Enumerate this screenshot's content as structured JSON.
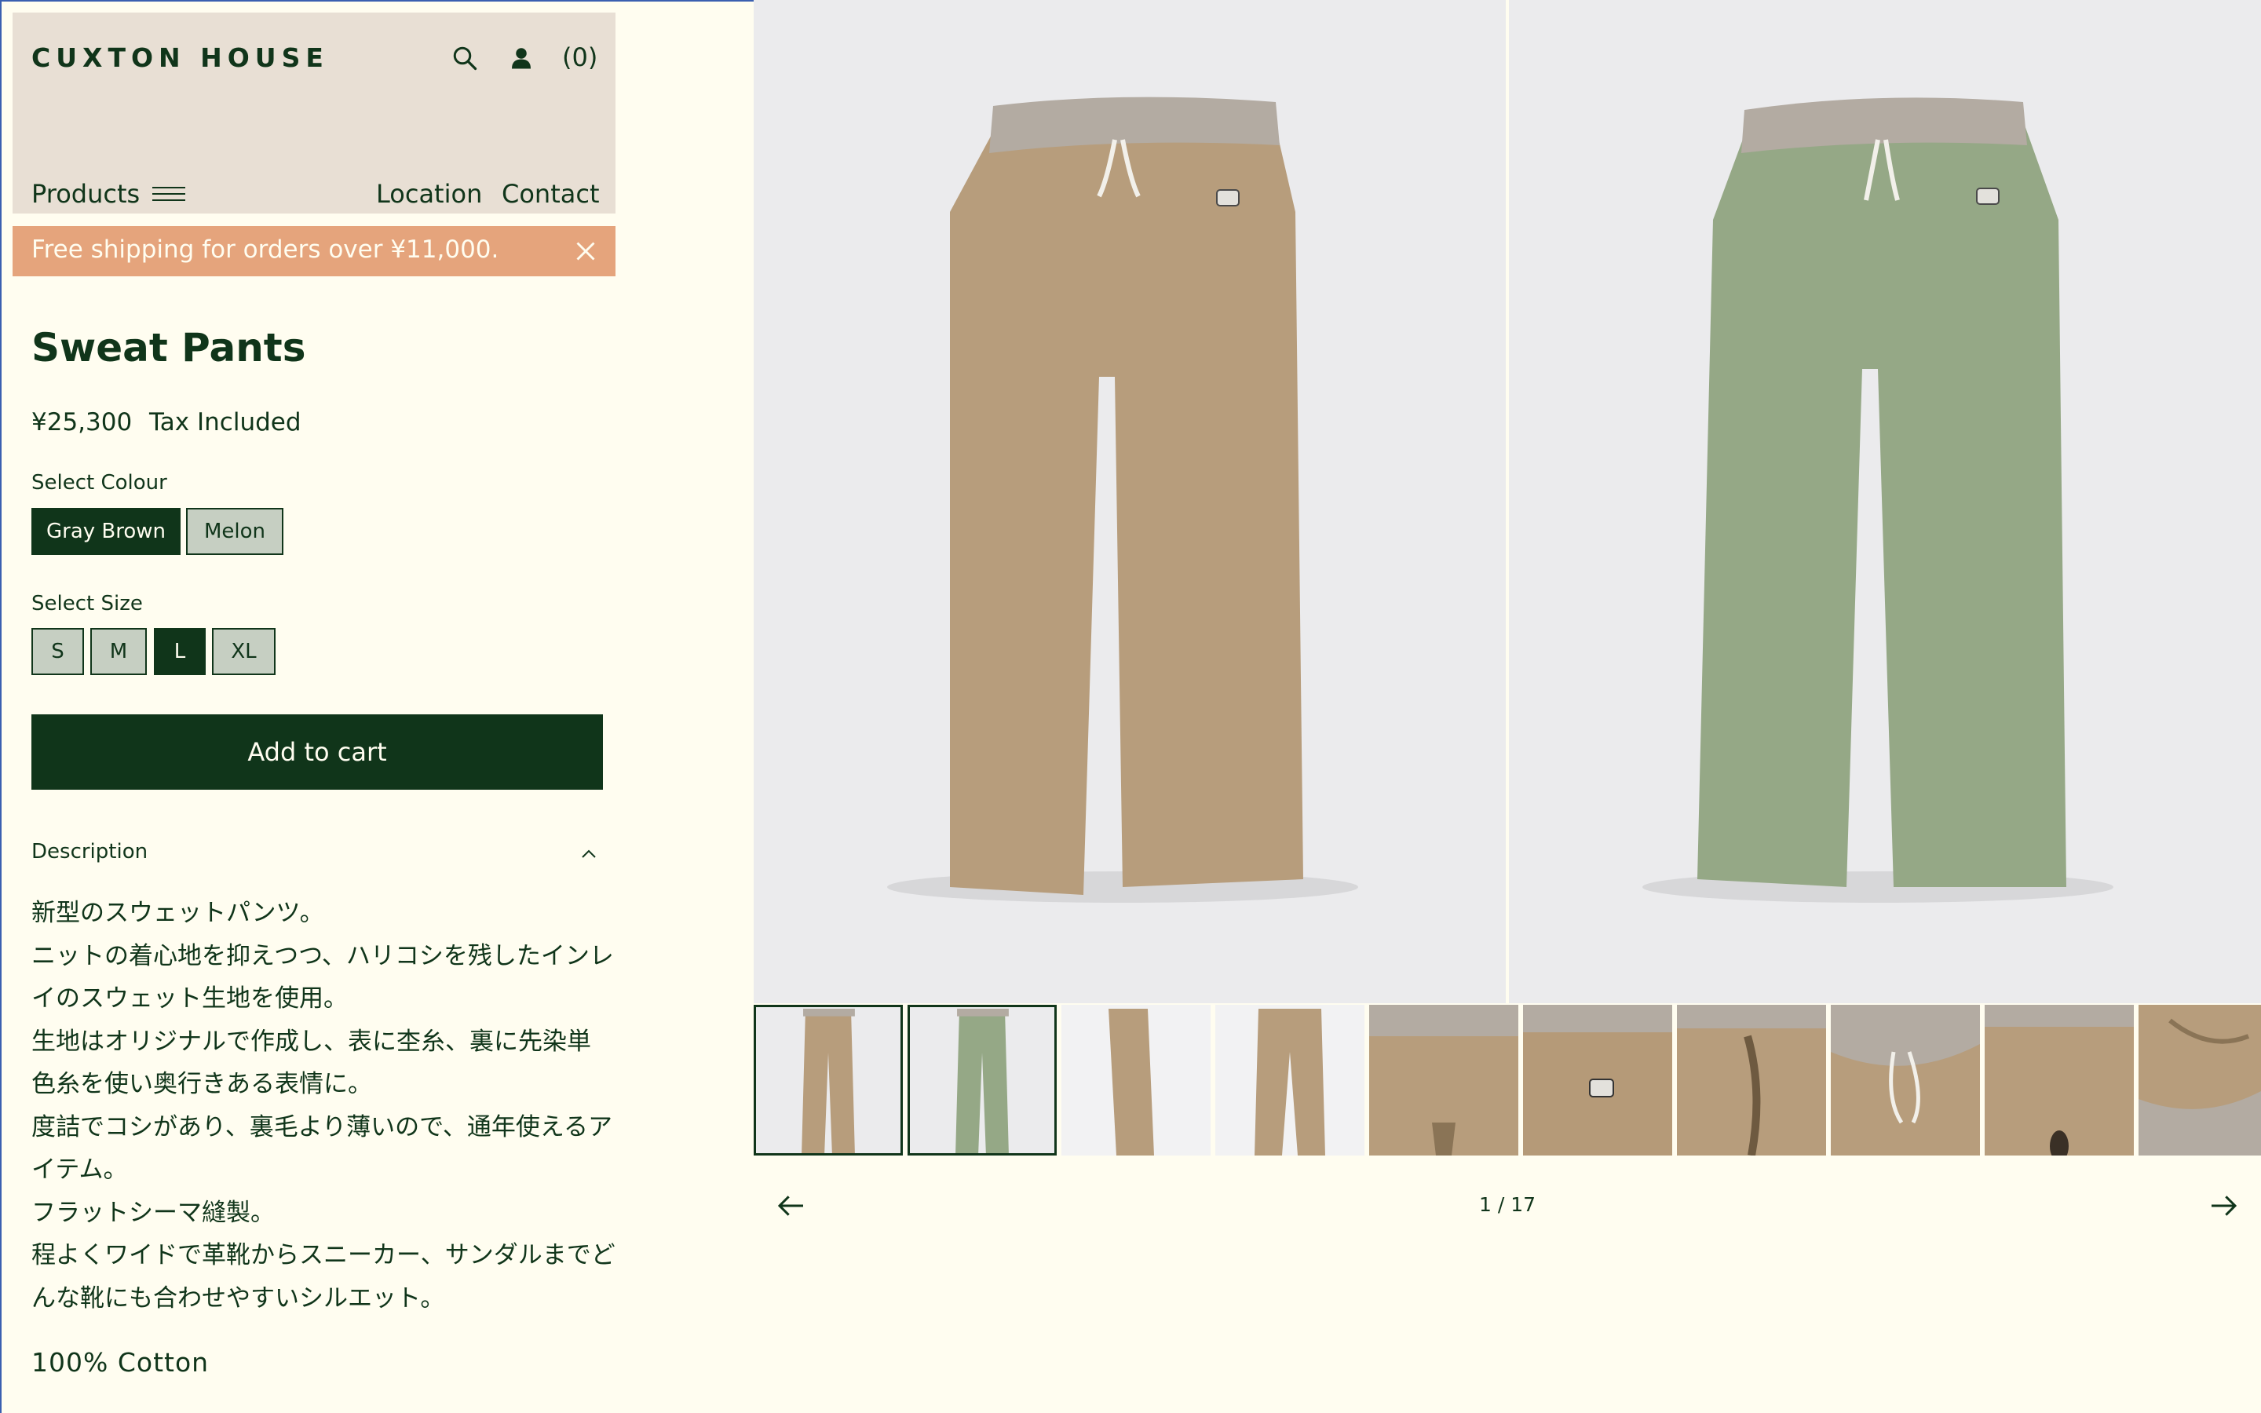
{
  "header": {
    "brand": "CUXTON HOUSE",
    "cart_count": "(0)",
    "nav": {
      "products": "Products",
      "location": "Location",
      "contact": "Contact"
    }
  },
  "banner": {
    "text": "Free shipping for orders over ¥11,000."
  },
  "product": {
    "title": "Sweat Pants",
    "price": "¥25,300",
    "tax_note": "Tax Included",
    "colour_label": "Select Colour",
    "colours": [
      "Gray Brown",
      "Melon"
    ],
    "selected_colour": "Gray Brown",
    "size_label": "Select Size",
    "sizes": [
      "S",
      "M",
      "L",
      "XL"
    ],
    "selected_size": "L",
    "add_to_cart": "Add to cart",
    "description_label": "Description",
    "description_lines": [
      "新型のスウェットパンツ。",
      "ニットの着心地を抑えつつ、ハリコシを残したインレ",
      "イのスウェット生地を使用。",
      "生地はオリジナルで作成し、表に杢糸、裏に先染単",
      "色糸を使い奥行きある表情に。",
      "度詰でコシがあり、裏毛より薄いので、通年使えるア",
      "イテム。",
      "フラットシーマ縫製。",
      "程よくワイドで革靴からスニーカー、サンダルまでど",
      "んな靴にも合わせやすいシルエット。"
    ],
    "material": "100% Cotton"
  },
  "gallery": {
    "counter": "1 / 17",
    "main_images": [
      "gray-brown-pants-photo",
      "melon-pants-photo"
    ],
    "thumbnails": 10
  },
  "colors": {
    "dark_green": "#10351a",
    "background": "#fffdf0",
    "header_bg": "#e8dfd4",
    "banner_bg": "#e5a47c",
    "option_bg": "#c6cfc2",
    "pants_brown": "#b79d7c",
    "pants_green": "#95a886",
    "waistband_gray": "#b3aba2"
  }
}
